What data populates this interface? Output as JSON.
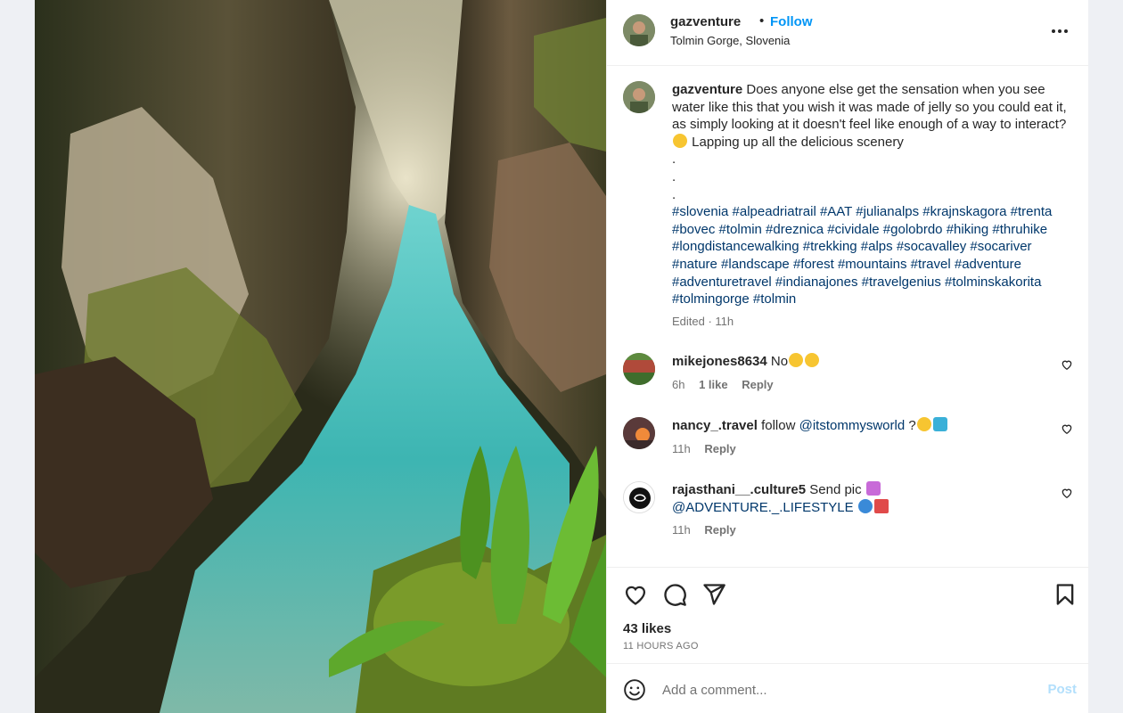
{
  "header": {
    "username": "gazventure",
    "separator": "•",
    "follow_label": "Follow",
    "location": "Tolmin Gorge, Slovenia"
  },
  "caption": {
    "username": "gazventure",
    "text": "Does anyone else get the sensation when you see water like this that you wish it was made of jelly so you could eat it, as simply looking at it doesn't feel like enough of a way to interact?",
    "text_after_emoji": "Lapping up all the delicious scenery",
    "dots": [
      ".",
      ".",
      "."
    ],
    "hashtags": "#slovenia #alpeadriatrail #AAT #julianalps #krajnskagora #trenta #bovec #tolmin #dreznica #cividale #golobrdo #hiking #thruhike #longdistancewalking #trekking #alps #socavalley #socariver #nature #landscape #forest #mountains #travel #adventure #adventuretravel #indianajones #travelgenius #tolminskakorita #tolmingorge #tolmin",
    "edited": "Edited · 11h"
  },
  "comments": [
    {
      "username": "mikejones8634",
      "text": "No",
      "time": "6h",
      "likes": "1 like",
      "reply": "Reply"
    },
    {
      "username": "nancy_.travel",
      "text": "follow",
      "mention": "@itstommysworld",
      "text_after": "?",
      "time": "11h",
      "reply": "Reply"
    },
    {
      "username": "rajasthani__.culture5",
      "text": "Send pic",
      "mention": "@ADVENTURE._.LIFESTYLE",
      "time": "11h",
      "reply": "Reply"
    }
  ],
  "actions": {
    "icons": [
      "heart-icon",
      "comment-icon",
      "share-icon",
      "bookmark-icon"
    ],
    "likes": "43 likes",
    "timestamp": "11 HOURS AGO"
  },
  "add_comment": {
    "placeholder": "Add a comment...",
    "post_label": "Post"
  },
  "colors": {
    "link_blue": "#0095f6",
    "hashtag": "#00376b",
    "muted": "#737373",
    "post_disabled": "#b2dffc"
  }
}
